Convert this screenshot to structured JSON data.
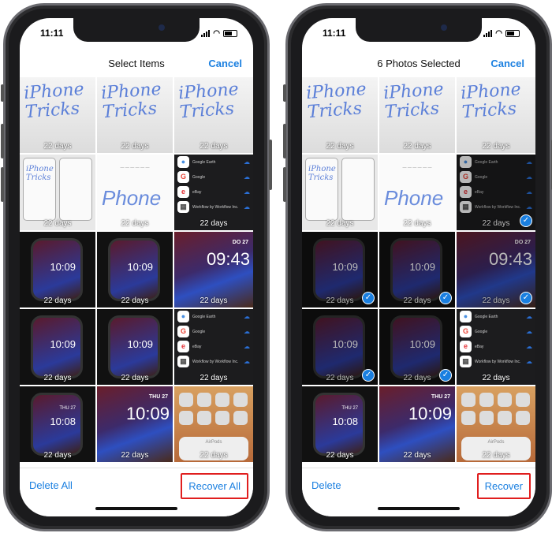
{
  "accent_color": "#1a7fe0",
  "highlight_color": "#e01e1e",
  "phones": [
    {
      "status": {
        "time": "11:11"
      },
      "nav": {
        "title": "Select Items",
        "cancel": "Cancel"
      },
      "toolbar": {
        "left": "Delete All",
        "right": "Recover All"
      },
      "selected": []
    },
    {
      "status": {
        "time": "11:11"
      },
      "nav": {
        "title": "6 Photos Selected",
        "cancel": "Cancel"
      },
      "toolbar": {
        "left": "Delete",
        "right": "Recover"
      },
      "selected": [
        5,
        6,
        7,
        8,
        9,
        10
      ]
    }
  ],
  "cells": [
    {
      "type": "board",
      "text": "iPhone Tricks",
      "days": "22 days"
    },
    {
      "type": "board",
      "text": "iPhone Tricks",
      "days": "22 days"
    },
    {
      "type": "board",
      "text": "iPhone Tricks",
      "days": "22 days"
    },
    {
      "type": "shots",
      "text": "iPhone Tricks",
      "days": "22 days"
    },
    {
      "type": "page",
      "text": "Phone",
      "days": "22 days"
    },
    {
      "type": "apps",
      "apps": [
        "Google Earth",
        "Google",
        "eBay",
        "Workflow by Workflow Inc."
      ],
      "days": "22 days"
    },
    {
      "type": "watch",
      "time": "10:09",
      "days": "22 days"
    },
    {
      "type": "watch",
      "time": "10:09",
      "days": "22 days"
    },
    {
      "type": "photo",
      "time": "09:43",
      "date": "DO 27",
      "days": "22 days"
    },
    {
      "type": "watch",
      "time": "10:09",
      "days": "22 days"
    },
    {
      "type": "watch",
      "time": "10:09",
      "days": "22 days"
    },
    {
      "type": "apps",
      "apps": [
        "Google Earth",
        "Google",
        "eBay",
        "Workflow by Workflow Inc."
      ],
      "days": "22 days"
    },
    {
      "type": "watch",
      "time": "10:08",
      "date": "THU 27",
      "days": "22 days"
    },
    {
      "type": "photo",
      "time": "10:09",
      "date": "THU 27",
      "days": "22 days"
    },
    {
      "type": "home",
      "label": "AirPods",
      "days": "22 days"
    }
  ]
}
